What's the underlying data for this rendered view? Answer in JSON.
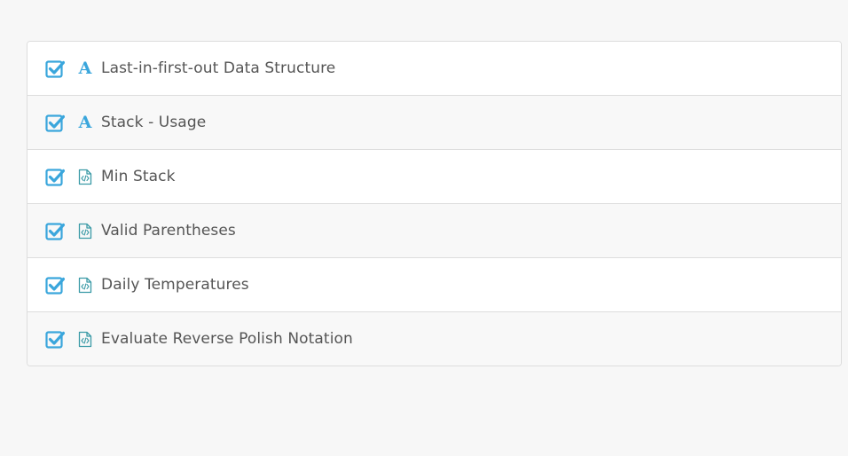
{
  "items": [
    {
      "label": "Last-in-first-out Data Structure",
      "icon": "article-icon",
      "icon_glyph": "A",
      "completed": true
    },
    {
      "label": "Stack - Usage",
      "icon": "article-icon",
      "icon_glyph": "A",
      "completed": true
    },
    {
      "label": "Min Stack",
      "icon": "code-file-icon",
      "completed": true
    },
    {
      "label": "Valid Parentheses",
      "icon": "code-file-icon",
      "completed": true
    },
    {
      "label": "Daily Temperatures",
      "icon": "code-file-icon",
      "completed": true
    },
    {
      "label": "Evaluate Reverse Polish Notation",
      "icon": "code-file-icon",
      "completed": true
    }
  ],
  "colors": {
    "check": "#3aa6dc",
    "article_icon": "#3aa6dc",
    "code_icon": "#3a9aa6",
    "text": "#555555"
  }
}
